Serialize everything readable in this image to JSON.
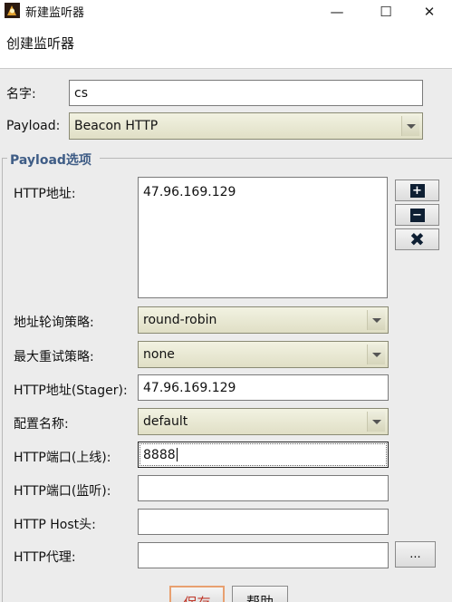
{
  "window": {
    "title": "新建监听器",
    "controls": {
      "minimize": "—",
      "maximize": "☐",
      "close": "✕"
    }
  },
  "header": {
    "subtitle": "创建监听器"
  },
  "form": {
    "name_label": "名字:",
    "name_value": "cs",
    "payload_label": "Payload:",
    "payload_value": "Beacon HTTP"
  },
  "payload_options": {
    "group_title": "Payload选项",
    "http_hosts_label": "HTTP地址:",
    "http_hosts_value": "47.96.169.129",
    "add_host_glyph": "+",
    "remove_host_glyph": "−",
    "clear_hosts_glyph": "✖",
    "rotation_label": "地址轮询策略:",
    "rotation_value": "round-robin",
    "retry_label": "最大重试策略:",
    "retry_value": "none",
    "stager_host_label": "HTTP地址(Stager):",
    "stager_host_value": "47.96.169.129",
    "profile_label": "配置名称:",
    "profile_value": "default",
    "port_c2_label": "HTTP端口(上线):",
    "port_c2_value": "8888",
    "port_bind_label": "HTTP端口(监听):",
    "port_bind_value": "",
    "host_header_label": "HTTP Host头:",
    "host_header_value": "",
    "proxy_label": "HTTP代理:",
    "proxy_value": "",
    "proxy_button_label": "..."
  },
  "footer": {
    "save_label": "保存",
    "help_label": "帮助"
  }
}
